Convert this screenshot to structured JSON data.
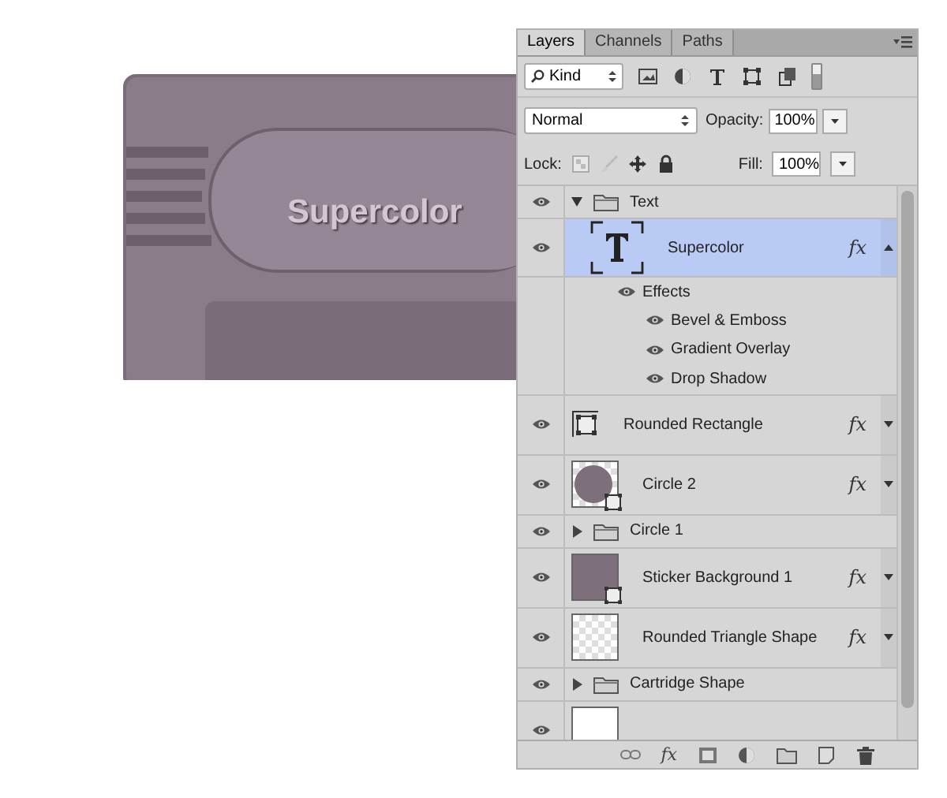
{
  "canvas": {
    "label": "Supercolor"
  },
  "panel": {
    "tabs": [
      {
        "label": "Layers",
        "selected": true
      },
      {
        "label": "Channels",
        "selected": false
      },
      {
        "label": "Paths",
        "selected": false
      }
    ],
    "filter": {
      "label": "Kind"
    },
    "blend_mode": {
      "value": "Normal"
    },
    "opacity": {
      "label": "Opacity:",
      "value": "100%"
    },
    "lock": {
      "label": "Lock:"
    },
    "fill": {
      "label": "Fill:",
      "value": "100%"
    },
    "layers": [
      {
        "kind": "group",
        "name": "Text",
        "expanded": true,
        "children": [
          {
            "kind": "type-layer",
            "name": "Supercolor",
            "selected": true,
            "fx_badge": "fx",
            "effects_expanded": true,
            "effects_label": "Effects",
            "effects": [
              "Bevel & Emboss",
              "Gradient Overlay",
              "Drop Shadow"
            ]
          }
        ]
      },
      {
        "kind": "shape-layer",
        "name": "Rounded Rectangle",
        "selected": false,
        "fx_badge": "fx",
        "effects_expanded": false
      },
      {
        "kind": "circle-layer",
        "name": "Circle 2",
        "selected": false,
        "fx_badge": "fx",
        "effects_expanded": false
      },
      {
        "kind": "group",
        "name": "Circle 1",
        "expanded": false
      },
      {
        "kind": "square-layer",
        "name": "Sticker Background 1",
        "selected": false,
        "fx_badge": "fx",
        "effects_expanded": false
      },
      {
        "kind": "transparent-layer",
        "name": "Rounded Triangle Shape",
        "selected": false,
        "fx_badge": "fx",
        "effects_expanded": false
      },
      {
        "kind": "group",
        "name": "Cartridge Shape",
        "expanded": false
      },
      {
        "kind": "white-layer",
        "selected": false
      }
    ],
    "bottom_bar": {
      "styles_label": "fx"
    }
  }
}
